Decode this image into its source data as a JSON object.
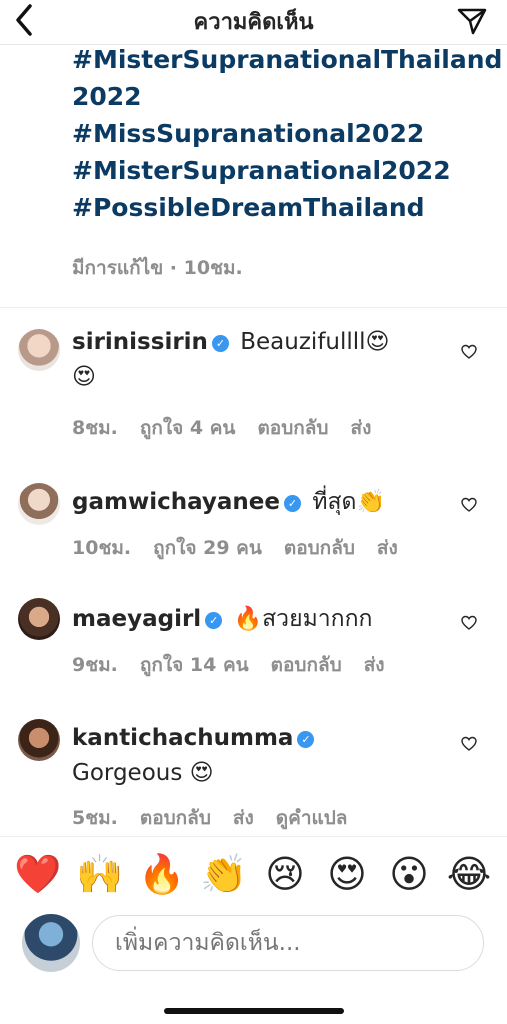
{
  "header": {
    "title": "ความคิดเห็น"
  },
  "caption": {
    "hashtags": [
      "#MisterSupranationalThailand",
      "2022",
      "#MissSupranational2022",
      "#MisterSupranational2022",
      "#PossibleDreamThailand"
    ],
    "meta": "มีการแก้ไข · 10ชม."
  },
  "comments": [
    {
      "username": "sirinissirin",
      "text": "Beauzifullll😍",
      "text2": "😍",
      "time": "8ชม.",
      "likes": "ถูกใจ 4 คน",
      "reply": "ตอบกลับ",
      "send": "ส่ง"
    },
    {
      "username": "gamwichayanee",
      "text": "ที่สุด👏",
      "time": "10ชม.",
      "likes": "ถูกใจ 29 คน",
      "reply": "ตอบกลับ",
      "send": "ส่ง"
    },
    {
      "username": "maeyagirl",
      "text": "🔥สวยมากกก",
      "time": "9ชม.",
      "likes": "ถูกใจ 14 คน",
      "reply": "ตอบกลับ",
      "send": "ส่ง"
    },
    {
      "username": "kantichachumma",
      "text": "Gorgeous 😍",
      "time": "5ชม.",
      "reply": "ตอบกลับ",
      "send": "ส่ง",
      "translate": "ดูคำแปล"
    }
  ],
  "emoji_bar": [
    "❤️",
    "🙌",
    "🔥",
    "👏",
    "😢",
    "😍",
    "😮",
    "😂"
  ],
  "input": {
    "placeholder": "เพิ่มความคิดเห็น..."
  },
  "colors": {
    "hashtag": "#0b3a63",
    "verified": "#3897f0",
    "meta": "#8e8e8e"
  }
}
